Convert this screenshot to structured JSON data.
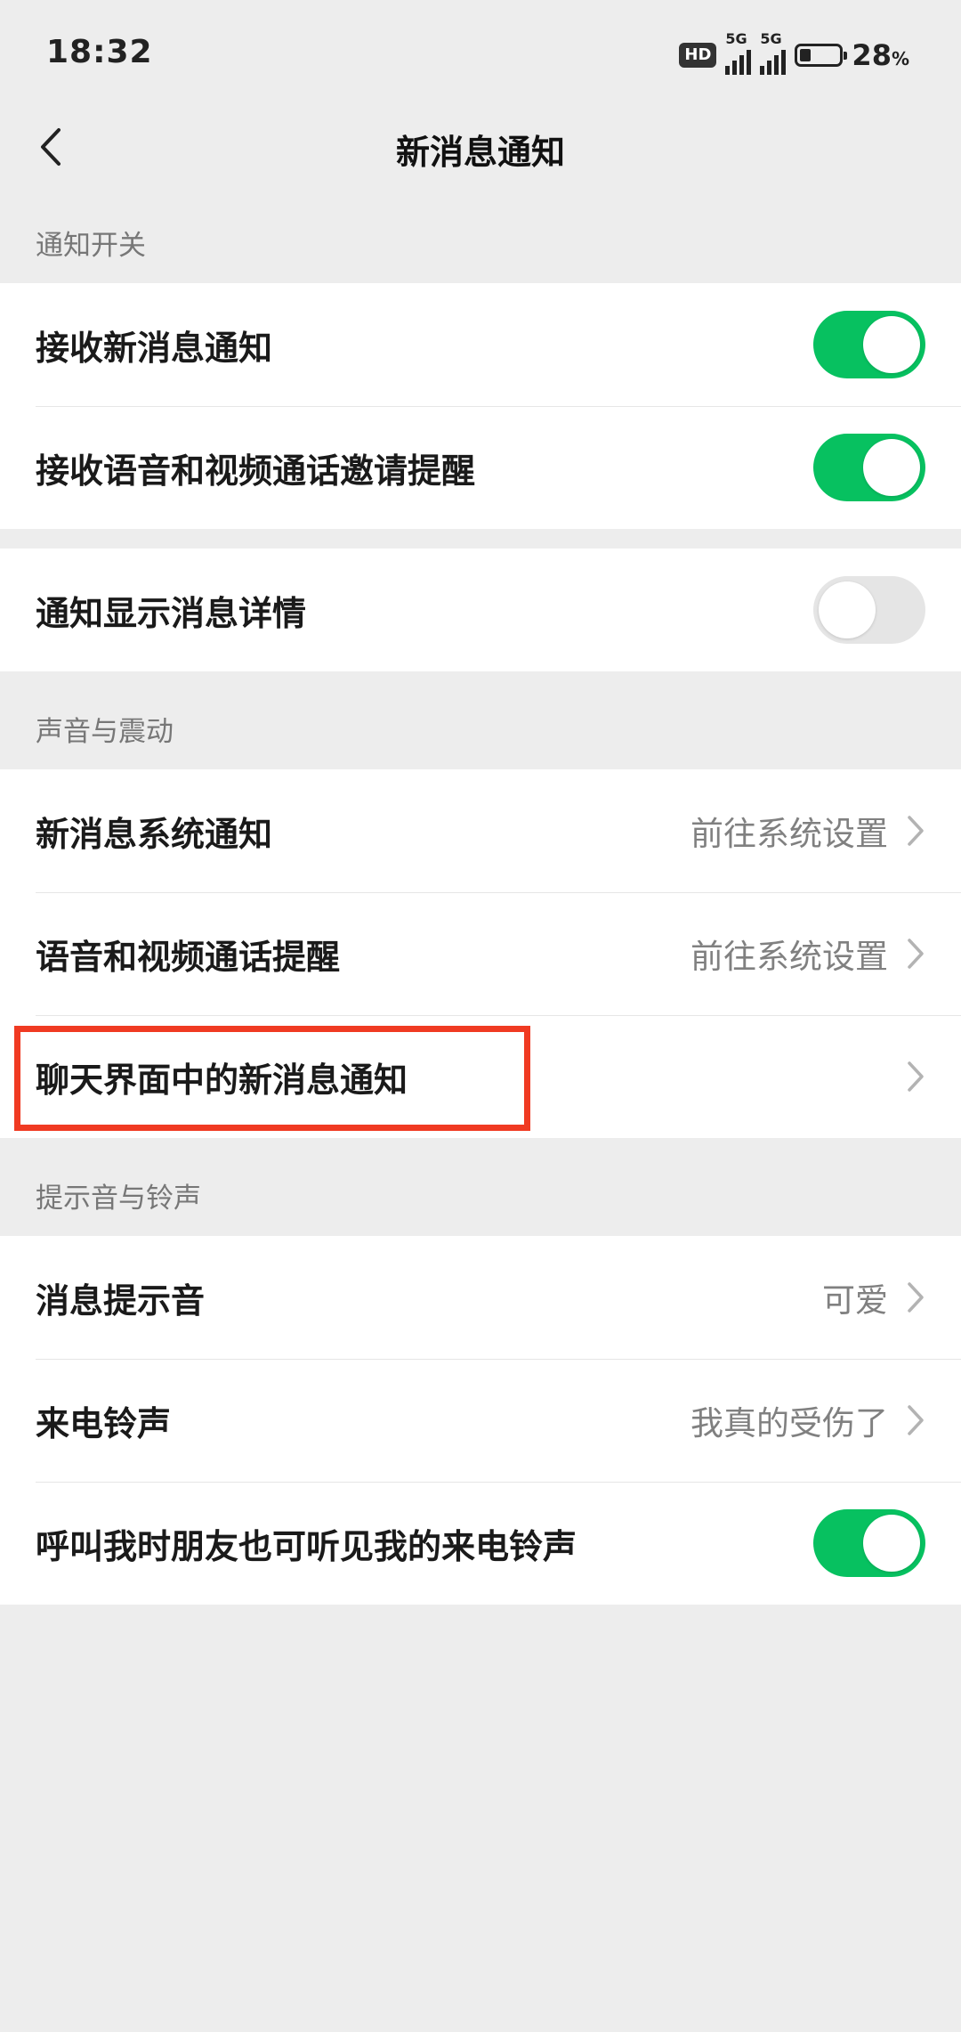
{
  "status_bar": {
    "time": "18:32",
    "hd_badge": "HD",
    "network1": "5G",
    "network2": "5G",
    "battery_percent": "28",
    "battery_unit": "%",
    "battery_level": 0.28
  },
  "nav": {
    "title": "新消息通知"
  },
  "sections": {
    "notification_switch": {
      "header": "通知开关",
      "rows": [
        {
          "label": "接收新消息通知",
          "toggle": true
        },
        {
          "label": "接收语音和视频通话邀请提醒",
          "toggle": true
        }
      ],
      "detail_row": {
        "label": "通知显示消息详情",
        "toggle": false
      }
    },
    "sound_vibration": {
      "header": "声音与震动",
      "rows": [
        {
          "label": "新消息系统通知",
          "value": "前往系统设置"
        },
        {
          "label": "语音和视频通话提醒",
          "value": "前往系统设置"
        },
        {
          "label": "聊天界面中的新消息通知",
          "value": ""
        }
      ]
    },
    "tones": {
      "header": "提示音与铃声",
      "rows": [
        {
          "label": "消息提示音",
          "value": "可爱"
        },
        {
          "label": "来电铃声",
          "value": "我真的受伤了"
        },
        {
          "label": "呼叫我时朋友也可听见我的来电铃声",
          "toggle": true
        }
      ]
    }
  },
  "colors": {
    "toggle_on": "#07c160",
    "toggle_off": "#e5e5e5",
    "highlight_box": "#f03a22",
    "background": "#ededed"
  }
}
